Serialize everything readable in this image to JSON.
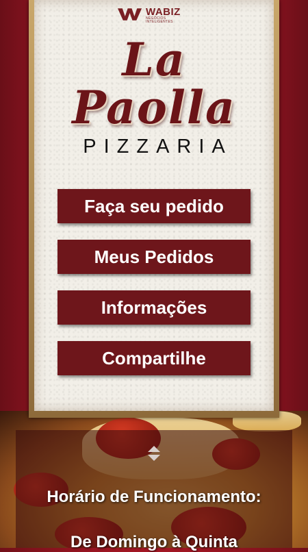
{
  "brand": {
    "vendor_name": "WABIZ",
    "vendor_tagline": "NEGÓCIOS INTELIGENTES",
    "logo_line1": "La",
    "logo_line2": "Paolla",
    "subtitle": "PIZZARIA"
  },
  "menu": {
    "items": [
      {
        "label": "Faça seu pedido"
      },
      {
        "label": "Meus Pedidos"
      },
      {
        "label": "Informações"
      },
      {
        "label": "Compartilhe"
      }
    ]
  },
  "hours": {
    "toggle_icon": "up-down-arrows-icon",
    "title": "Horário de Funcionamento:",
    "line1": "De Domingo à Quinta"
  },
  "colors": {
    "background_red": "#b3192a",
    "button_bg": "#6e161b",
    "logo_text": "#6b1418",
    "panel_bg": "#f2efe8"
  }
}
